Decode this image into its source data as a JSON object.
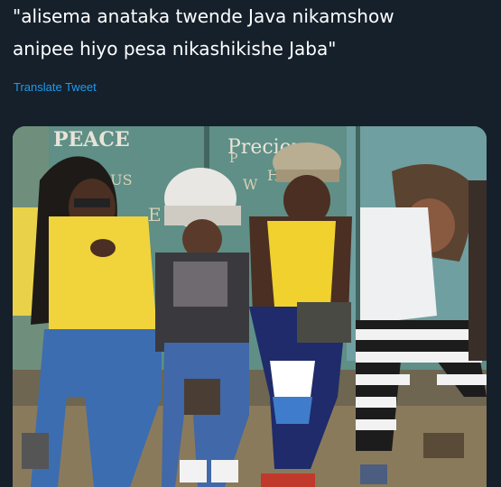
{
  "tweet": {
    "text_line1": "\"alisema anataka twende Java nikamshow",
    "text_line2": "anipee hiyo pesa nikashikishe Jaba\"",
    "translate_label": "Translate Tweet"
  },
  "media": {
    "wall_text": {
      "peace": "PEACE",
      "precious": "Precious",
      "ous": "OUS",
      "e": "E",
      "w": "W",
      "h": "H",
      "p": "P"
    },
    "colors": {
      "wall": "#5f8f86",
      "ground": "#8a7a5c",
      "shirt_yellow": "#f3d23a",
      "jeans_blue": "#3c6db0"
    }
  }
}
